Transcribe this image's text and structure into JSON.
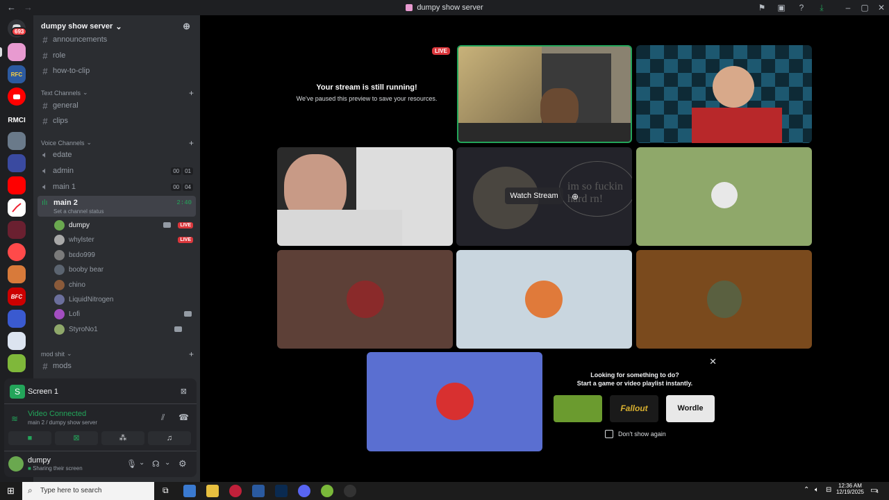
{
  "window": {
    "title": "dumpy show server"
  },
  "server_list": {
    "mention_badge": "693",
    "rmci_label": "RMCI",
    "bfc_label": "BFC",
    "rfc_label": "RFC"
  },
  "server": {
    "name": "dumpy show server"
  },
  "channels": {
    "top": [
      "announcements",
      "role",
      "how-to-clip"
    ],
    "text_category": "Text Channels",
    "text": [
      "general",
      "clips"
    ],
    "voice_category": "Voice Channels",
    "voice": [
      {
        "name": "edate"
      },
      {
        "name": "admin",
        "count": "00",
        "limit": "01"
      },
      {
        "name": "main 1",
        "count": "00",
        "limit": "04"
      }
    ],
    "active_voice": {
      "name": "main 2",
      "timer": "2:40",
      "status": "Set a channel status"
    },
    "members": [
      {
        "name": "dumpy",
        "live": "LIVE",
        "color": "#6aa84f"
      },
      {
        "name": "whylster",
        "live": "LIVE",
        "color": "#a8a8a8"
      },
      {
        "name": "bɛdo999",
        "color": "#7a7a7a"
      },
      {
        "name": "booby bear",
        "color": "#5b6470"
      },
      {
        "name": "chino",
        "color": "#8a5a3a"
      },
      {
        "name": "LiquidNitrogen",
        "color": "#6b6f9c"
      },
      {
        "name": "Lofi",
        "color": "#a34ec0"
      },
      {
        "name": "StyroNo1",
        "color": "#8fa86a"
      }
    ],
    "mod_category": "mod shit",
    "mod": [
      "mods"
    ]
  },
  "screen_panel": {
    "title": "Screen 1",
    "connected": "Video Connected",
    "location": "main 2 / dumpy show server"
  },
  "account": {
    "username": "dumpy",
    "status": "Sharing their screen"
  },
  "stage": {
    "live_badge": "LIVE",
    "paused_title": "Your stream is still running!",
    "paused_sub": "We've paused this preview to save your resources.",
    "watch_stream": "Watch Stream",
    "stream_overlay_text": "im so fuckin\nhard rn!",
    "activity_title": "Looking for something to do?",
    "activity_sub": "Start a game or video playlist instantly.",
    "dont_show": "Don't show again",
    "activities": [
      {
        "label": "",
        "color": "#6b9b2f"
      },
      {
        "label": "Fallout",
        "color": "#1a1a1a"
      },
      {
        "label": "Wordle",
        "color": "#e8e8e8"
      }
    ]
  },
  "taskbar": {
    "search_placeholder": "Type here to search",
    "time": "12:36 AM",
    "date": "12/19/2025",
    "notification_count": "4"
  },
  "colors": {
    "accent": "#5865f2",
    "live": "#da373c",
    "green": "#23a55a",
    "tile_brown": "#5d4037",
    "tile_light": "#c9d6df",
    "tile_orange": "#7a4a1d",
    "tile_green": "#8fa86a",
    "tile_blue": "#5a6fd1"
  }
}
